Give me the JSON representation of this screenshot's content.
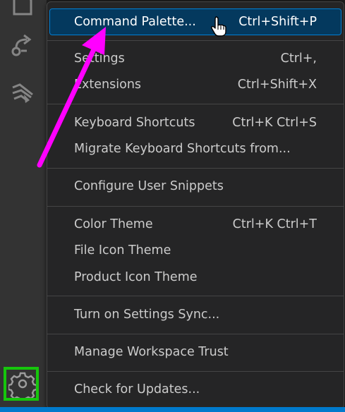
{
  "menu": {
    "items": [
      {
        "label": "Command Palette...",
        "shortcut": "Ctrl+Shift+P"
      },
      {
        "label": "Settings",
        "shortcut": "Ctrl+,"
      },
      {
        "label": "Extensions",
        "shortcut": "Ctrl+Shift+X"
      },
      {
        "label": "Keyboard Shortcuts",
        "shortcut": "Ctrl+K Ctrl+S"
      },
      {
        "label": "Migrate Keyboard Shortcuts from...",
        "shortcut": ""
      },
      {
        "label": "Configure User Snippets",
        "shortcut": ""
      },
      {
        "label": "Color Theme",
        "shortcut": "Ctrl+K Ctrl+T"
      },
      {
        "label": "File Icon Theme",
        "shortcut": ""
      },
      {
        "label": "Product Icon Theme",
        "shortcut": ""
      },
      {
        "label": "Turn on Settings Sync...",
        "shortcut": ""
      },
      {
        "label": "Manage Workspace Trust",
        "shortcut": ""
      },
      {
        "label": "Check for Updates...",
        "shortcut": ""
      }
    ]
  },
  "activity_bar": {
    "icons": [
      "explorer-icon",
      "remote-icon",
      "testing-icon",
      "gear-icon"
    ]
  },
  "annotation": {
    "arrow_color": "#ff00ff",
    "highlight_color": "#16c60c"
  },
  "colors": {
    "menu_background": "#252526",
    "active_item": "#04395e",
    "text": "#cccccc",
    "status_bar": "#007acc"
  }
}
